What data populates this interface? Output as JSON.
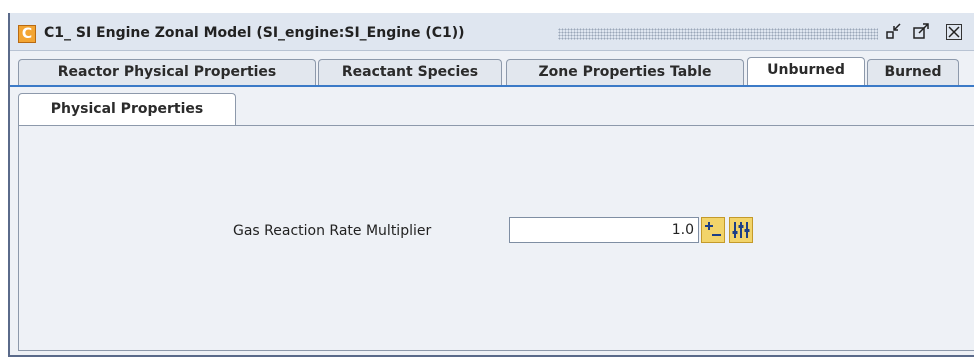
{
  "window": {
    "title": "C1_ SI Engine Zonal Model  (SI_engine:SI_Engine (C1))",
    "app_icon_letter": "C",
    "controls": {
      "minimize": "⤡",
      "maximize": "⤢",
      "close": "✕"
    }
  },
  "tabs": [
    {
      "label": "Reactor Physical Properties",
      "active": false
    },
    {
      "label": "Reactant Species",
      "active": false
    },
    {
      "label": "Zone Properties Table",
      "active": false
    },
    {
      "label": "Unburned",
      "active": true
    },
    {
      "label": "Burned",
      "active": false
    }
  ],
  "subtabs": [
    {
      "label": "Physical Properties",
      "active": true
    }
  ],
  "form": {
    "field_label": "Gas Reaction Rate Multiplier",
    "field_value": "1.0"
  },
  "colors": {
    "accent": "#3b7ac7",
    "tab_bg": "#e2e7ee",
    "panel_bg": "#eef1f6",
    "icon_yellow": "#f2d46a"
  }
}
